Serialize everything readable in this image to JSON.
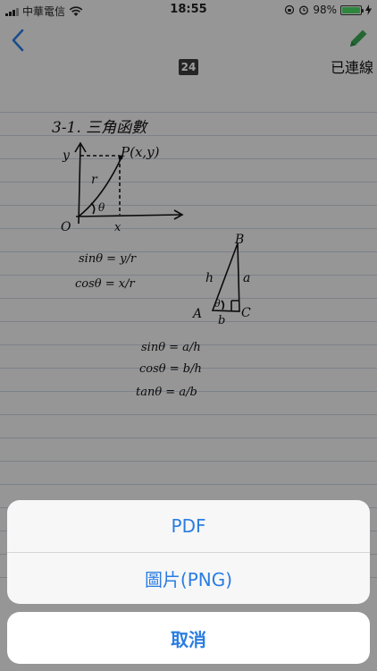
{
  "status_bar": {
    "carrier": "中華電信",
    "time": "18:55",
    "battery": "98%",
    "battery_level": 0.98
  },
  "nav": {
    "back_icon": "chevron-left-icon",
    "edit_icon": "pencil-icon",
    "connected_label": "已連線",
    "page_number": "24"
  },
  "note": {
    "heading": "3-1. 三角函數",
    "point_label": "P(x,y)",
    "axis_y": "y",
    "axis_x": "x",
    "origin": "O",
    "radius": "r",
    "angle": "θ",
    "eq1": "sinθ = y/r",
    "eq2": "cosθ = x/r",
    "tri_a": "A",
    "tri_b": "B",
    "tri_c": "C",
    "side_h": "h",
    "side_a": "a",
    "side_b": "b",
    "eq3": "sinθ = a/h",
    "eq4": "cosθ = b/h",
    "eq5": "tanθ = a/b"
  },
  "action_sheet": {
    "options": [
      "PDF",
      "圖片(PNG)"
    ],
    "cancel": "取消"
  },
  "colors": {
    "accent": "#2a7de1",
    "edit_green": "#3aa655",
    "battery_green": "#4cd964"
  }
}
